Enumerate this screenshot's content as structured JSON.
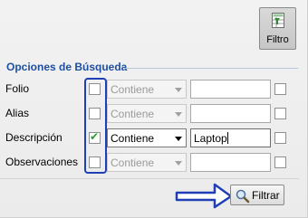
{
  "toolbar": {
    "filtro_label": "Filtro"
  },
  "section": {
    "title": "Opciones de Búsqueda"
  },
  "rows": [
    {
      "label": "Folio",
      "checked": false,
      "operator": "Contiene",
      "operator_enabled": false,
      "value": ""
    },
    {
      "label": "Alias",
      "checked": false,
      "operator": "Contiene",
      "operator_enabled": false,
      "value": ""
    },
    {
      "label": "Descripción",
      "checked": true,
      "operator": "Contiene",
      "operator_enabled": true,
      "value": "Laptop"
    },
    {
      "label": "Observaciones",
      "checked": false,
      "operator": "Contiene",
      "operator_enabled": false,
      "value": ""
    }
  ],
  "actions": {
    "filtrar_label": "Filtrar"
  },
  "colors": {
    "section_title": "#1f4fa0",
    "highlight": "#1f3fb5",
    "arrow": "#1f3fb5",
    "check": "#2a9d2a"
  },
  "icons": {
    "filtro": "filter-table-icon",
    "filtrar": "magnifier-icon"
  }
}
